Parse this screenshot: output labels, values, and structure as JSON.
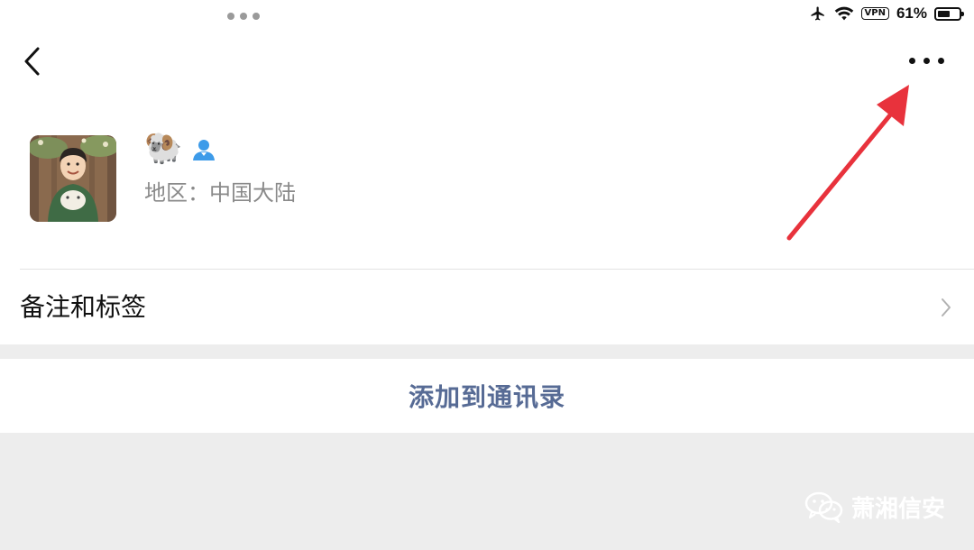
{
  "status_bar": {
    "vpn_label": "VPN",
    "battery_text": "61%",
    "battery_level": 0.61
  },
  "header": {
    "back_icon": "chevron-left-icon",
    "more_icon": "more-horizontal-icon"
  },
  "profile": {
    "nickname_emoji": "🐏",
    "region": "地区：中国大陆"
  },
  "remark_row": {
    "label": "备注和标签"
  },
  "add_button": {
    "label": "添加到通讯录"
  },
  "watermark": {
    "text": "萧湘信安"
  },
  "colors": {
    "link_blue": "#576b95",
    "annotation_red": "#e8323c",
    "page_bg": "#ededed"
  }
}
